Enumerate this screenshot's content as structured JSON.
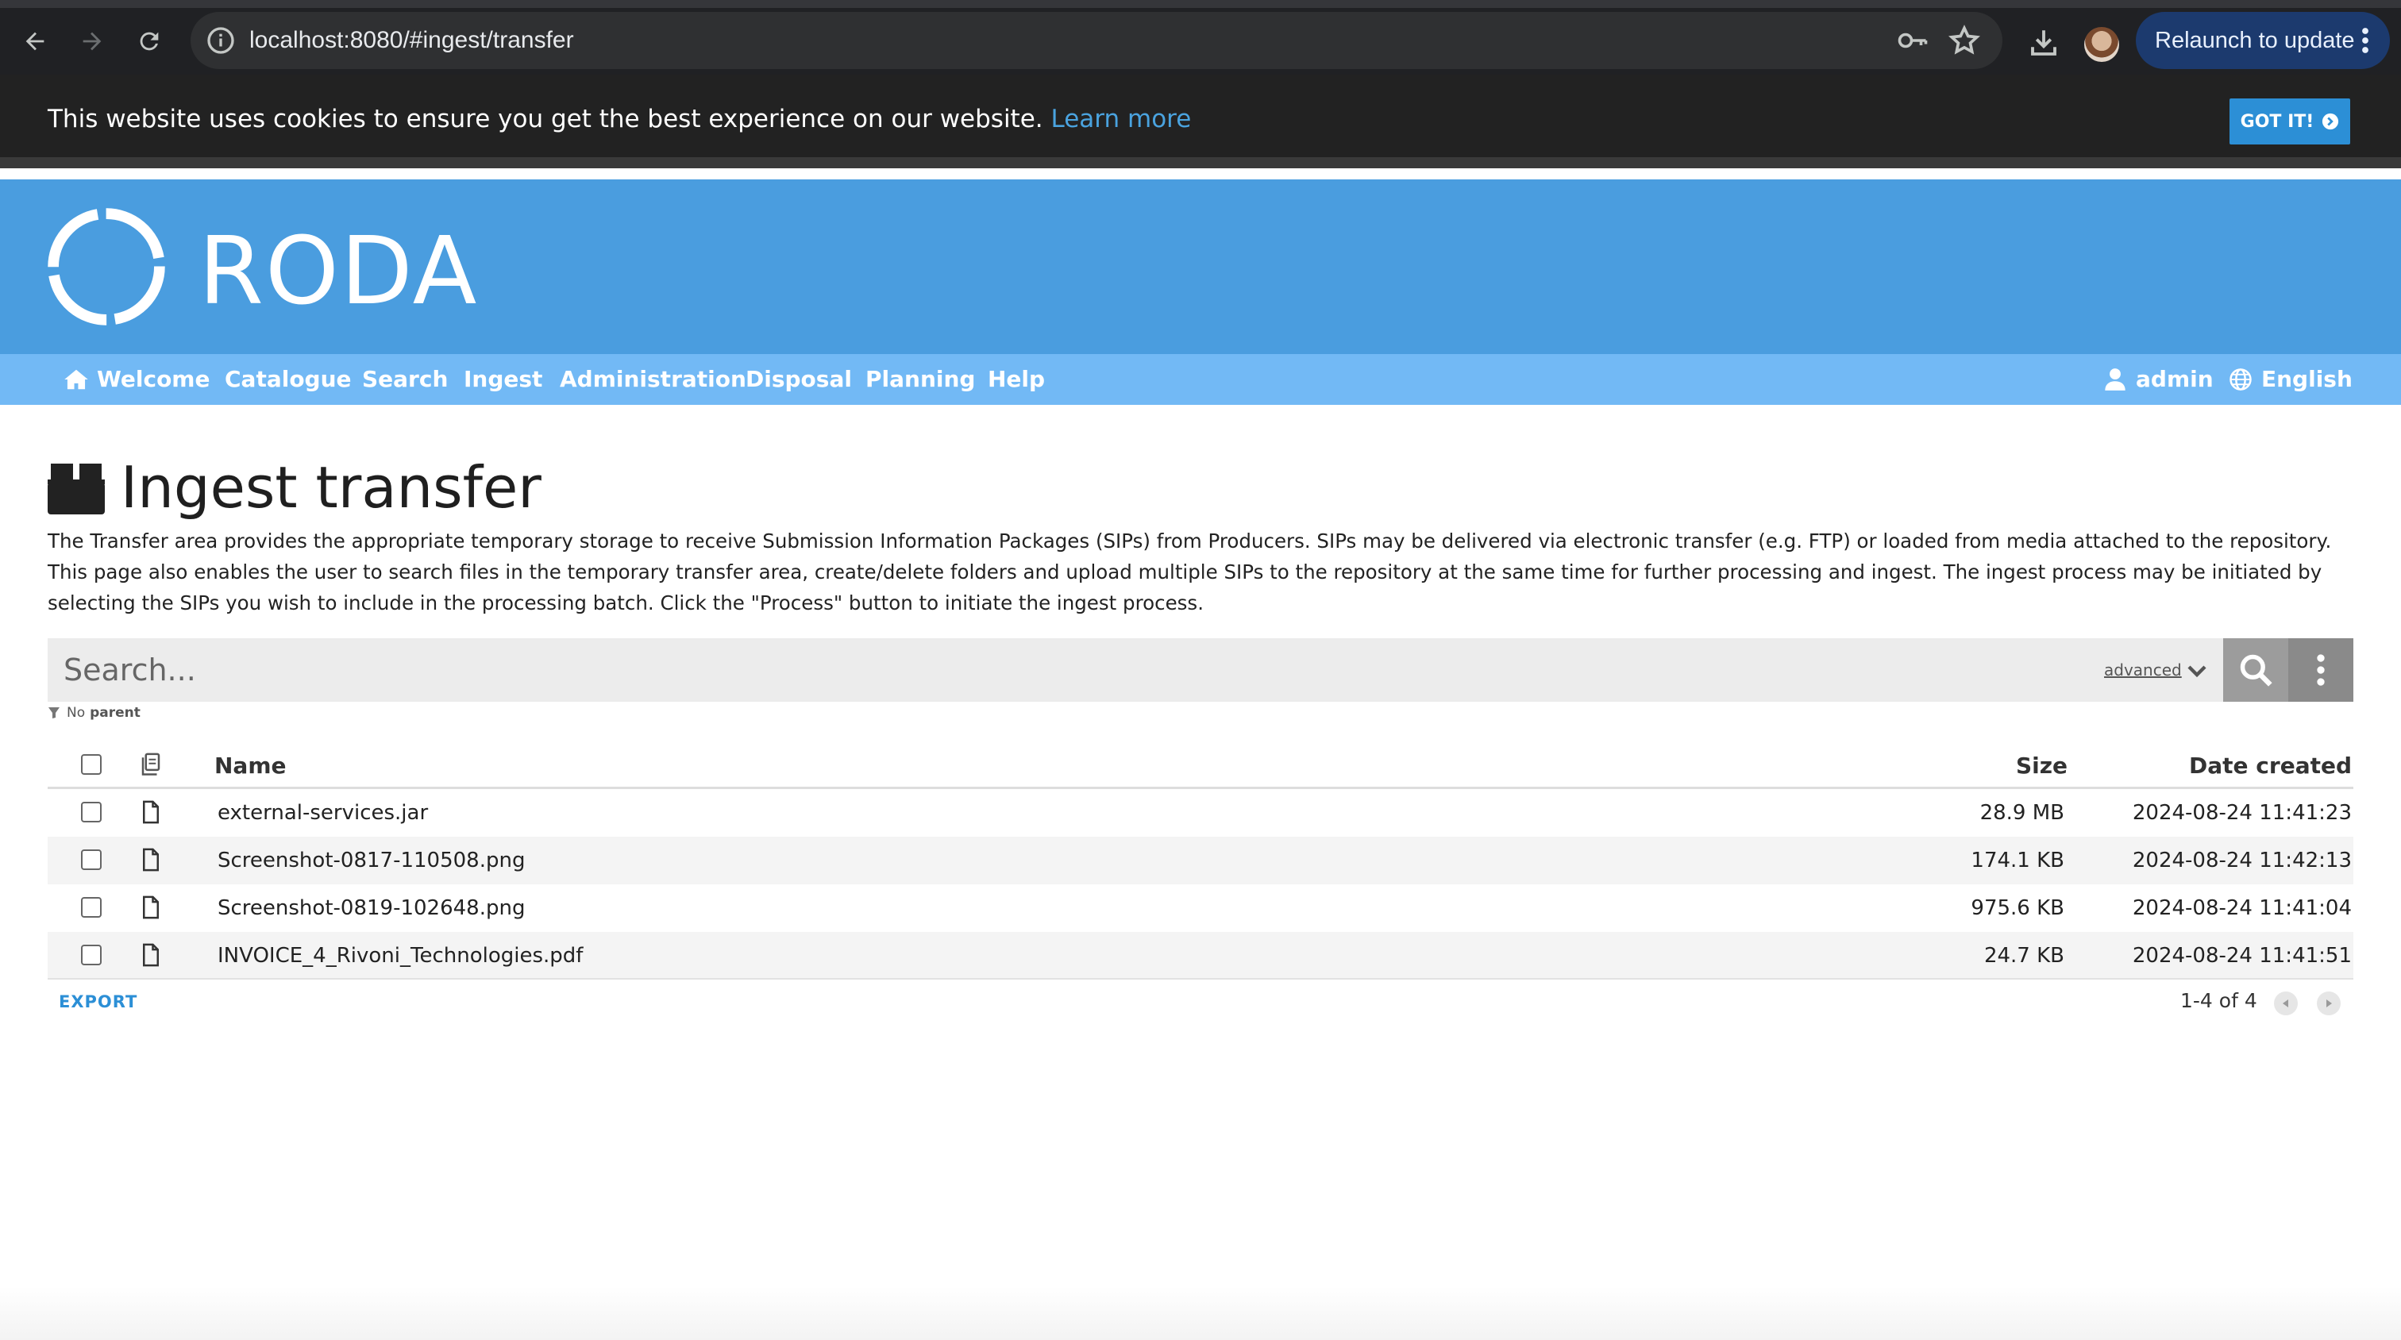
{
  "browser": {
    "url": "localhost:8080/#ingest/transfer",
    "relaunch_label": "Relaunch to update"
  },
  "cookie": {
    "message": "This website uses cookies to ensure you get the best experience on our website.",
    "learn_more": "Learn more",
    "got_it": "GOT IT!"
  },
  "brand": {
    "name": "RODA"
  },
  "menu": {
    "items": [
      "Welcome",
      "Catalogue",
      "Search",
      "Ingest",
      "Administration",
      "Disposal",
      "Planning",
      "Help"
    ],
    "user": "admin",
    "language": "English"
  },
  "page": {
    "title": "Ingest transfer",
    "description": "The Transfer area provides the appropriate temporary storage to receive Submission Information Packages (SIPs) from Producers. SIPs may be delivered via electronic transfer (e.g. FTP) or loaded from media attached to the repository. This page also enables the user to search files in the temporary transfer area, create/delete folders and upload multiple SIPs to the repository at the same time for further processing and ingest. The ingest process may be initiated by selecting the SIPs you wish to include in the processing batch. Click the \"Process\" button to initiate the ingest process."
  },
  "search": {
    "placeholder": "Search...",
    "advanced": "advanced",
    "filter_label": "No",
    "filter_value": "parent"
  },
  "table": {
    "headers": {
      "name": "Name",
      "size": "Size",
      "date": "Date created"
    },
    "rows": [
      {
        "name": "external-services.jar",
        "size": "28.9 MB",
        "date": "2024-08-24 11:41:23"
      },
      {
        "name": "Screenshot-0817-110508.png",
        "size": "174.1 KB",
        "date": "2024-08-24 11:42:13"
      },
      {
        "name": "Screenshot-0819-102648.png",
        "size": "975.6 KB",
        "date": "2024-08-24 11:41:04"
      },
      {
        "name": "INVOICE_4_Rivoni_Technologies.pdf",
        "size": "24.7 KB",
        "date": "2024-08-24 11:41:51"
      }
    ]
  },
  "footer": {
    "export": "EXPORT",
    "pagination": "1-4 of 4"
  },
  "colors": {
    "header_blue": "#4a9ddf",
    "menu_blue": "#72b9f5",
    "accent": "#2c8fd6",
    "cookie_bg": "#222222"
  }
}
